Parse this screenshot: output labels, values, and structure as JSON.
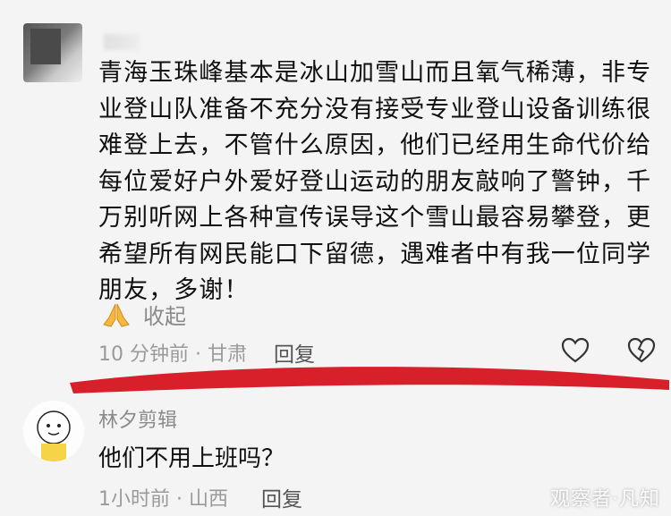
{
  "comment1": {
    "text": "青海玉珠峰基本是冰山加雪山而且氧气稀薄，非专业登山队准备不充分没有接受专业登山设备训练很难登上去，不管什么原因，他们已经用生命代价给每位爱好户外爱好登山运动的朋友敲响了警钟，千万别听网上各种宣传误导这个雪山最容易攀登，更希望所有网民能口下留德，遇难者中有我一位同学朋友，多谢！",
    "collapse_label": "收起",
    "time_location": "10 分钟前 · 甘肃",
    "reply_label": "回复"
  },
  "comment2": {
    "username": "林夕剪辑",
    "text": "他们不用上班吗？",
    "time_location": "1小时前 · 山西",
    "reply_label": "回复"
  },
  "watermark": "观察者·凡知",
  "colors": {
    "highlight_stroke": "#d8202a",
    "background": "#f4f4f4"
  },
  "icons": [
    "pray-hands-icon",
    "heart-icon",
    "broken-heart-icon"
  ]
}
